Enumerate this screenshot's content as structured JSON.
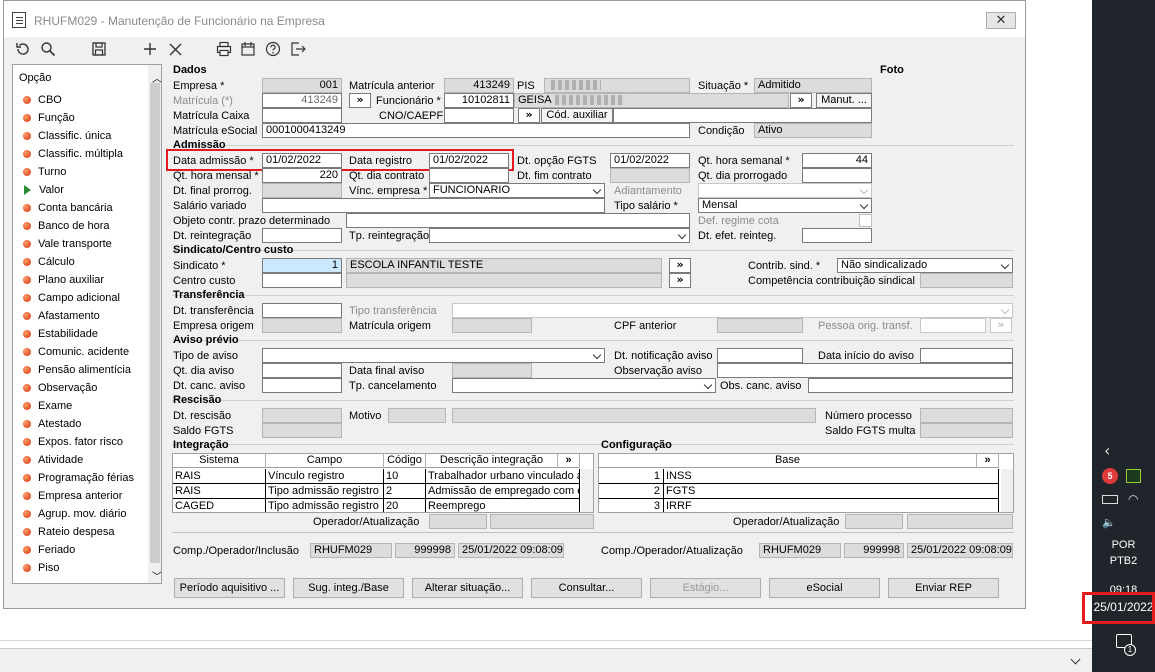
{
  "window": {
    "title": "RHUFM029 - Manutenção de Funcionário na Empresa",
    "close": "✕"
  },
  "sidebar": {
    "header": "Opção",
    "items": [
      "CBO",
      "Função",
      "Classific. única",
      "Classific. múltipla",
      "Turno",
      "Valor",
      "Conta bancária",
      "Banco de hora",
      "Vale transporte",
      "Cálculo",
      "Plano auxiliar",
      "Campo adicional",
      "Afastamento",
      "Estabilidade",
      "Comunic. acidente",
      "Pensão alimentícia",
      "Observação",
      "Exame",
      "Atestado",
      "Expos. fator risco",
      "Atividade",
      "Programação férias",
      "Empresa anterior",
      "Agrup. mov. diário",
      "Rateio despesa",
      "Feriado",
      "Piso"
    ],
    "selected": "Valor"
  },
  "dados": {
    "section": "Dados",
    "empresa_lbl": "Empresa *",
    "empresa": "001",
    "mat_ant_lbl": "Matrícula anterior",
    "mat_ant": "413249",
    "pis_lbl": "PIS",
    "situacao_lbl": "Situação *",
    "situacao": "Admitido",
    "matricula_lbl": "Matrícula (*)",
    "matricula": "413249",
    "funcionario_lbl": "Funcionário *",
    "funcionario": "10102811",
    "nome": "GEISA",
    "manut": "Manut. ...",
    "mat_caixa_lbl": "Matrícula Caixa",
    "cno_lbl": "CNO/CAEPF",
    "cod_aux": "Cód. auxiliar",
    "mat_esocial_lbl": "Matrícula eSocial",
    "mat_esocial": "0001000413249",
    "condicao_lbl": "Condição",
    "condicao": "Ativo",
    "foto": "Foto"
  },
  "admissao": {
    "section": "Admissão",
    "data_adm_lbl": "Data admissão *",
    "data_adm": "01/02/2022",
    "data_reg_lbl": "Data registro",
    "data_reg": "01/02/2022",
    "dt_fgts_lbl": "Dt. opção FGTS",
    "dt_fgts": "01/02/2022",
    "qt_hs_lbl": "Qt. hora semanal *",
    "qt_hs": "44",
    "qt_hm_lbl": "Qt. hora mensal *",
    "qt_hm": "220",
    "qt_dc_lbl": "Qt. dia contrato",
    "dt_fim_lbl": "Dt. fim contrato",
    "qt_dp_lbl": "Qt. dia prorrogado",
    "dt_final_lbl": "Dt. final prorrog.",
    "vinc_lbl": "Vínc. empresa *",
    "vinc": "FUNCIONARIO",
    "adiant_lbl": "Adiantamento",
    "sal_var_lbl": "Salário variado",
    "tipo_sal_lbl": "Tipo salário *",
    "tipo_sal": "Mensal",
    "obj_lbl": "Objeto contr. prazo determinado",
    "def_lbl": "Def. regime cota",
    "dt_reint_lbl": "Dt. reintegração",
    "tp_reint_lbl": "Tp. reintegração",
    "dt_efet_lbl": "Dt. efet. reinteg."
  },
  "sindicato": {
    "section": "Sindicato/Centro custo",
    "sind_lbl": "Sindicato *",
    "sind": "1",
    "sind_nome": "ESCOLA INFANTIL TESTE",
    "cc_lbl": "Centro custo",
    "contrib_lbl": "Contrib. sind. *",
    "contrib": "Não sindicalizado",
    "comp_lbl": "Competência contribuição sindical"
  },
  "transf": {
    "section": "Transferência",
    "dt_lbl": "Dt. transferência",
    "tipo_lbl": "Tipo transferência",
    "emp_lbl": "Empresa origem",
    "mat_lbl": "Matrícula origem",
    "cpf_lbl": "CPF anterior",
    "pessoa_lbl": "Pessoa orig. transf."
  },
  "aviso": {
    "section": "Aviso prévio",
    "tipo_lbl": "Tipo de aviso",
    "dt_not_lbl": "Dt. notificação aviso",
    "dt_ini_lbl": "Data início do aviso",
    "qt_lbl": "Qt. dia aviso",
    "dt_final_lbl": "Data final aviso",
    "obs_lbl": "Observação aviso",
    "dt_canc_lbl": "Dt. canc. aviso",
    "tp_canc_lbl": "Tp. cancelamento",
    "obs_canc_lbl": "Obs. canc. aviso"
  },
  "rescisao": {
    "section": "Rescisão",
    "dt_lbl": "Dt. rescisão",
    "motivo_lbl": "Motivo",
    "num_lbl": "Número processo",
    "saldo_lbl": "Saldo FGTS",
    "saldo_multa_lbl": "Saldo FGTS multa"
  },
  "integracao": {
    "section": "Integração",
    "columns": [
      "Sistema",
      "Campo",
      "Código",
      "Descrição integração"
    ],
    "rows": [
      [
        "RAIS",
        "Vínculo registro",
        "10",
        "Trabalhador urbano vinculado a"
      ],
      [
        "RAIS",
        "Tipo admissão registro",
        "2",
        "Admissão de empregado com e"
      ],
      [
        "CAGED",
        "Tipo admissão registro",
        "20",
        "Reemprego"
      ]
    ],
    "op_lbl": "Operador/Atualização"
  },
  "config": {
    "section": "Configuração",
    "col": "Base",
    "rows": [
      [
        "1",
        "INSS"
      ],
      [
        "2",
        "FGTS"
      ],
      [
        "3",
        "IRRF"
      ]
    ],
    "op_lbl": "Operador/Atualização"
  },
  "footer": {
    "inc_lbl": "Comp./Operador/Inclusão",
    "inc_prog": "RHUFM029",
    "inc_op": "999998",
    "inc_dt": "25/01/2022 09:08:09",
    "atu_lbl": "Comp./Operador/Atualização",
    "atu_prog": "RHUFM029",
    "atu_op": "999998",
    "atu_dt": "25/01/2022 09:08:09"
  },
  "buttons": [
    "Período aquisitivo ...",
    "Sug. integ./Base",
    "Alterar situação...",
    "Consultar...",
    "Estágio...",
    "eSocial",
    "Enviar REP"
  ],
  "taskbar": {
    "lang1": "POR",
    "lang2": "PTB2",
    "time": "09:18",
    "date": "25/01/2022",
    "badge": "1"
  },
  "symbols": {
    "more": "»"
  }
}
